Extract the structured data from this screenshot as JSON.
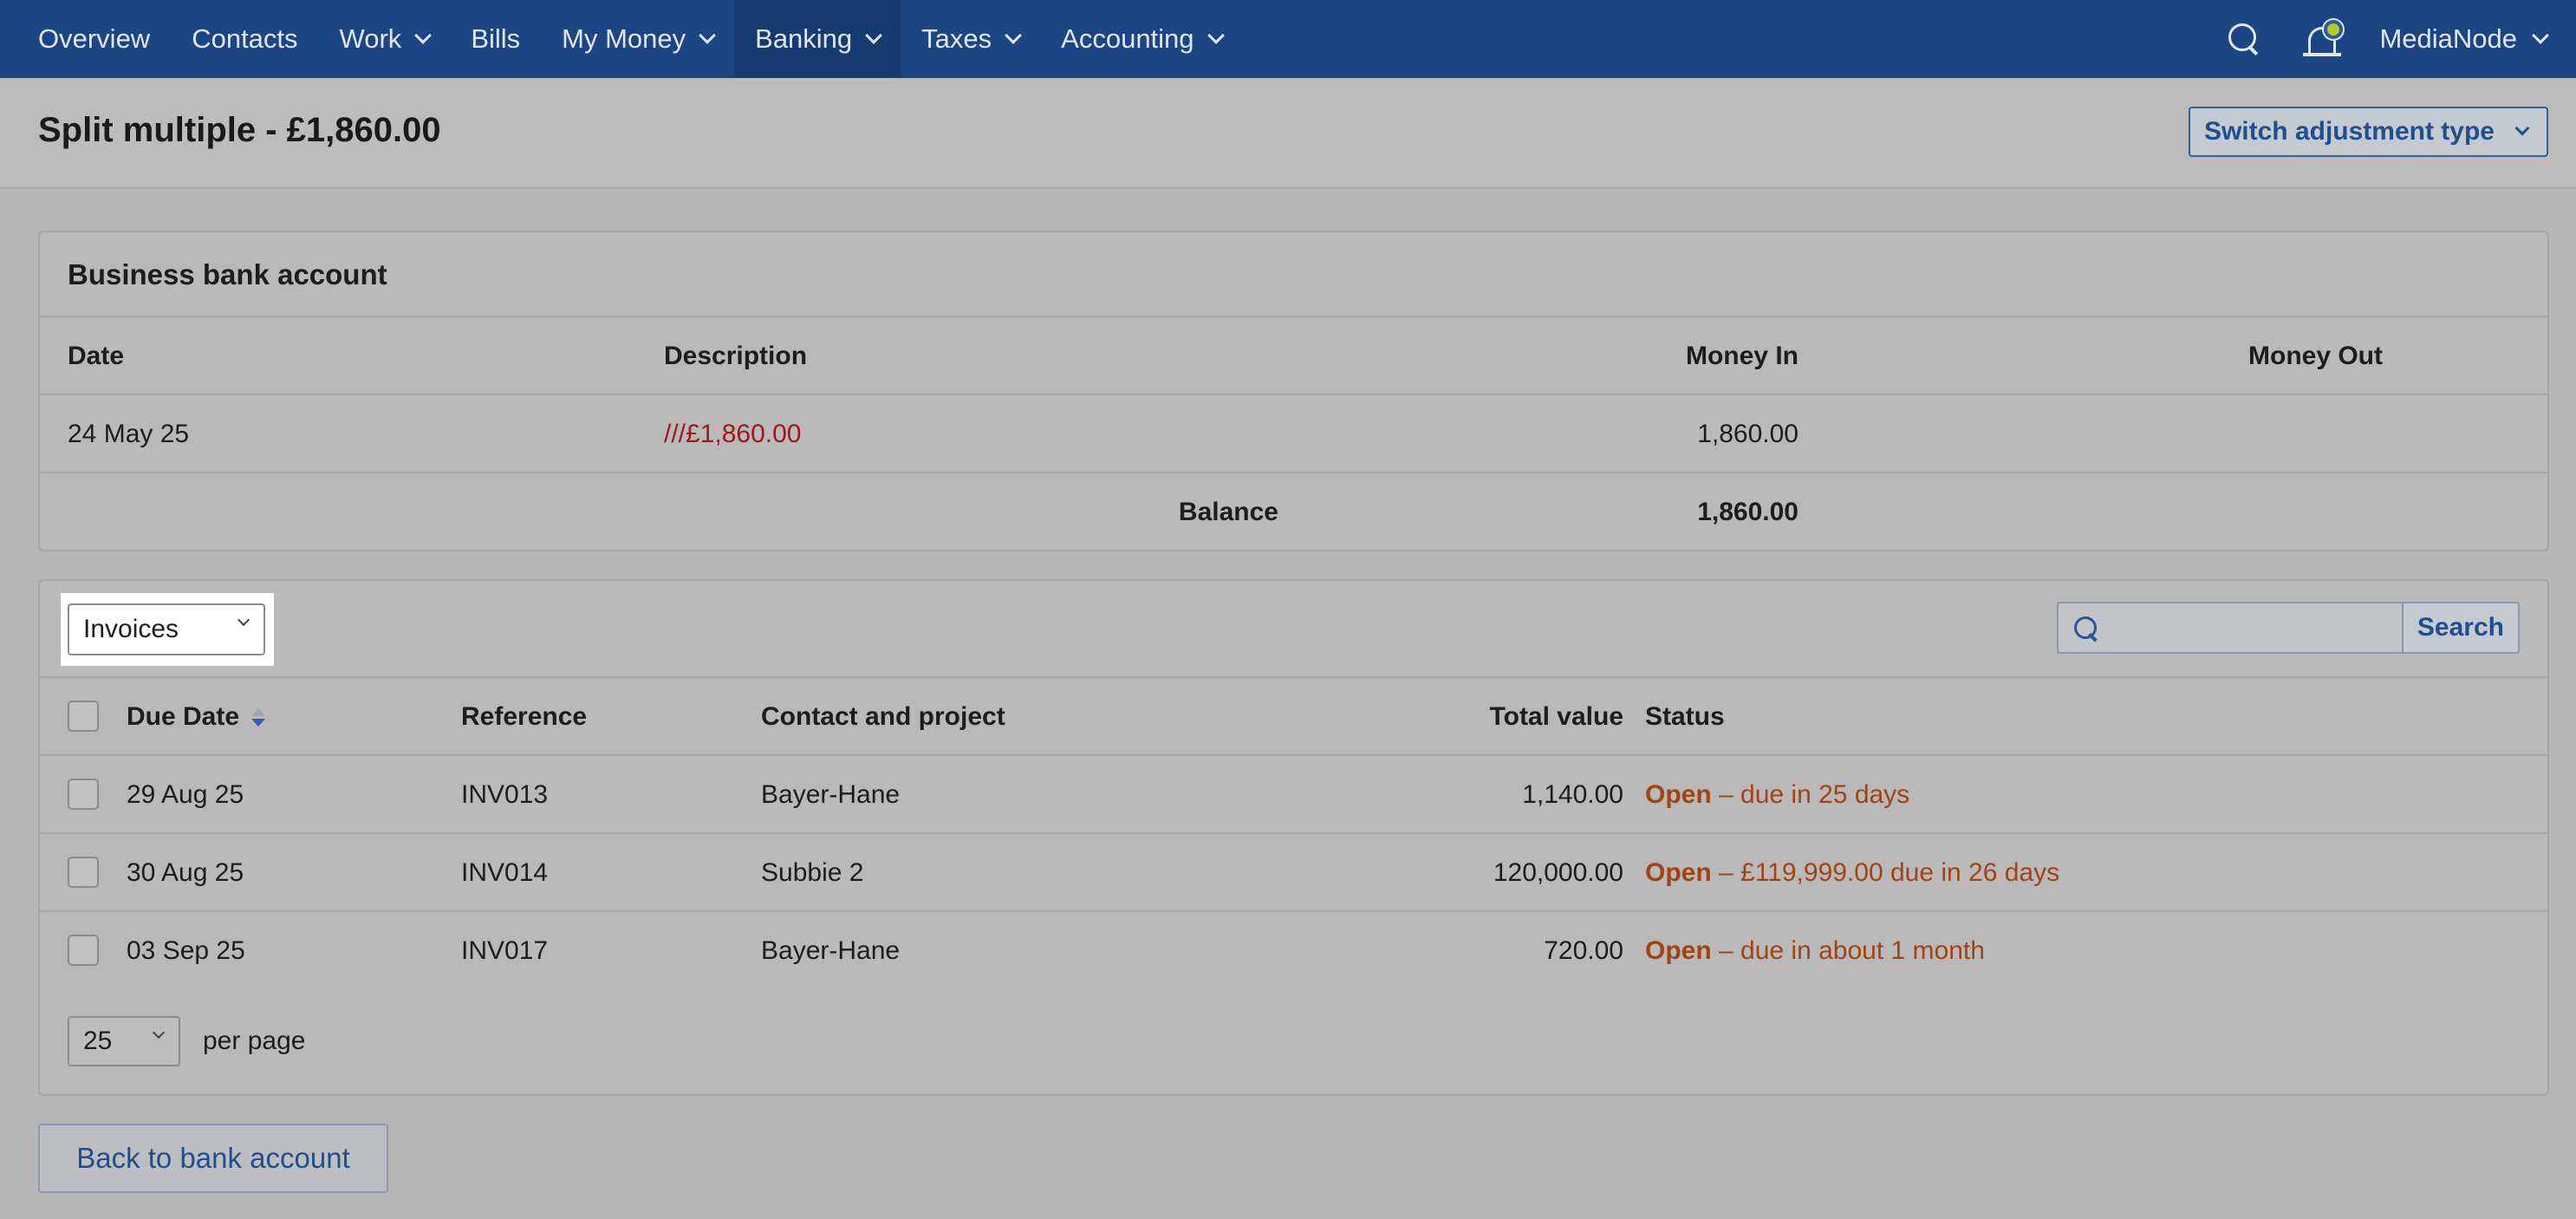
{
  "nav": {
    "items": [
      {
        "label": "Overview",
        "dropdown": false,
        "active": false
      },
      {
        "label": "Contacts",
        "dropdown": false,
        "active": false
      },
      {
        "label": "Work",
        "dropdown": true,
        "active": false
      },
      {
        "label": "Bills",
        "dropdown": false,
        "active": false
      },
      {
        "label": "My Money",
        "dropdown": true,
        "active": false
      },
      {
        "label": "Banking",
        "dropdown": true,
        "active": true
      },
      {
        "label": "Taxes",
        "dropdown": true,
        "active": false
      },
      {
        "label": "Accounting",
        "dropdown": true,
        "active": false
      }
    ],
    "account_name": "MediaNode"
  },
  "header": {
    "title": "Split multiple - £1,860.00",
    "switch_label": "Switch adjustment type"
  },
  "bank": {
    "title": "Business bank account",
    "columns": [
      "Date",
      "Description",
      "Money In",
      "Money Out"
    ],
    "row": {
      "date": "24 May 25",
      "description": "///£1,860.00",
      "money_in": "1,860.00",
      "money_out": ""
    },
    "balance_label": "Balance",
    "balance_value": "1,860.00"
  },
  "invoices": {
    "type_selected": "Invoices",
    "search_button": "Search",
    "search_value": "",
    "columns": {
      "due_date": "Due Date",
      "reference": "Reference",
      "contact": "Contact and project",
      "total": "Total value",
      "status": "Status"
    },
    "rows": [
      {
        "due_date": "29 Aug 25",
        "reference": "INV013",
        "contact": "Bayer-Hane",
        "total": "1,140.00",
        "status_open": "Open",
        "status_rest": "– due in 25 days"
      },
      {
        "due_date": "30 Aug 25",
        "reference": "INV014",
        "contact": "Subbie 2",
        "total": "120,000.00",
        "status_open": "Open",
        "status_rest": "– £119,999.00 due in 26 days"
      },
      {
        "due_date": "03 Sep 25",
        "reference": "INV017",
        "contact": "Bayer-Hane",
        "total": "720.00",
        "status_open": "Open",
        "status_rest": "– due in about 1 month"
      }
    ],
    "per_page_value": "25",
    "per_page_label": "per page"
  },
  "footer": {
    "back_label": "Back to bank account"
  },
  "colors": {
    "nav_bg": "#1c4584",
    "accent": "#1f4f8f",
    "status": "#a44312",
    "description_link": "#a11818"
  }
}
